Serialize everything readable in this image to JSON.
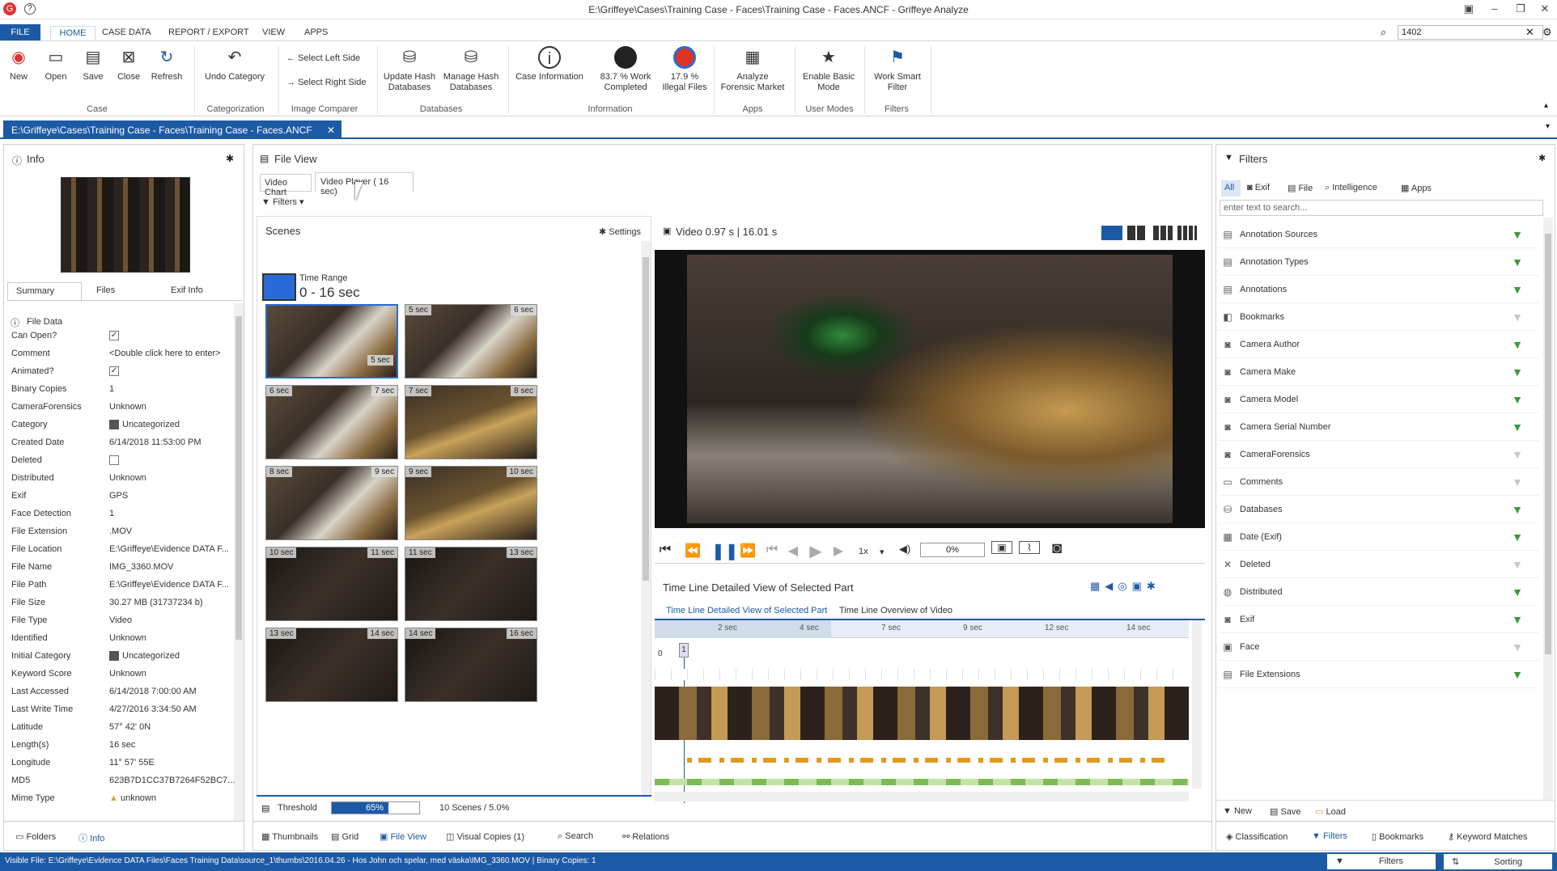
{
  "window": {
    "title": "E:\\Griffeye\\Cases\\Training Case - Faces\\Training Case - Faces.ANCF - Griffeye Analyze",
    "search_value": "1402"
  },
  "menu_tabs": [
    "FILE",
    "HOME",
    "CASE DATA",
    "REPORT / EXPORT",
    "VIEW",
    "APPS"
  ],
  "ribbon": {
    "new": "New",
    "open": "Open",
    "save": "Save",
    "close": "Close",
    "refresh": "Refresh",
    "undo_category": "Undo Category",
    "select_left": "Select Left Side",
    "select_right": "Select Right Side",
    "update_hash": "Update Hash Databases",
    "manage_hash": "Manage Hash Databases",
    "case_information": "Case Information",
    "work_completed": "83.7 % Work Completed",
    "illegal_files": "17.9 % Illegal Files",
    "analyze_market": "Analyze Forensic Market",
    "enable_basic": "Enable Basic Mode",
    "work_smart": "Work Smart Filter",
    "groups": {
      "case": "Case",
      "categorization": "Categorization",
      "image_comparer": "Image Comparer",
      "databases": "Databases",
      "information": "Information",
      "apps": "Apps",
      "user_modes": "User Modes",
      "filters": "Filters"
    }
  },
  "doc_tab": "E:\\Griffeye\\Cases\\Training Case - Faces\\Training Case - Faces.ANCF",
  "info_panel": {
    "title": "Info",
    "tabs": [
      "Summary",
      "Files",
      "Exif Info"
    ],
    "section": "File Data",
    "rows": [
      {
        "k": "Can Open?",
        "v": ""
      },
      {
        "k": "Comment",
        "v": "<Double click here to enter>"
      },
      {
        "k": "Animated?",
        "v": ""
      },
      {
        "k": "Binary Copies",
        "v": "1"
      },
      {
        "k": "CameraForensics",
        "v": "Unknown"
      },
      {
        "k": "Category",
        "v": "Uncategorized"
      },
      {
        "k": "Created Date",
        "v": "6/14/2018 11:53:00 PM"
      },
      {
        "k": "Deleted",
        "v": ""
      },
      {
        "k": "Distributed",
        "v": "Unknown"
      },
      {
        "k": "Exif",
        "v": "GPS"
      },
      {
        "k": "Face Detection",
        "v": "1"
      },
      {
        "k": "File Extension",
        "v": ".MOV"
      },
      {
        "k": "File Location",
        "v": "E:\\Griffeye\\Evidence DATA F..."
      },
      {
        "k": "File Name",
        "v": "IMG_3360.MOV"
      },
      {
        "k": "File Path",
        "v": "E:\\Griffeye\\Evidence DATA F..."
      },
      {
        "k": "File Size",
        "v": "30.27 MB  (31737234 b)"
      },
      {
        "k": "File Type",
        "v": "Video"
      },
      {
        "k": "Identified",
        "v": "Unknown"
      },
      {
        "k": "Initial Category",
        "v": "Uncategorized"
      },
      {
        "k": "Keyword Score",
        "v": "Unknown"
      },
      {
        "k": "Last Accessed",
        "v": "6/14/2018 7:00:00 AM"
      },
      {
        "k": "Last Write Time",
        "v": "4/27/2016 3:34:50 AM"
      },
      {
        "k": "Latitude",
        "v": "57° 42' 0N"
      },
      {
        "k": "Length(s)",
        "v": " 16 sec"
      },
      {
        "k": "Longitude",
        "v": "11° 57' 55E"
      },
      {
        "k": "MD5",
        "v": "623B7D1CC37B7264F52BC7..."
      },
      {
        "k": "Mime Type",
        "v": "unknown"
      }
    ],
    "bottom_tabs": [
      "Folders",
      "Info"
    ]
  },
  "file_view": {
    "title": "File View",
    "tabs": [
      "Video Chart",
      "Video Player ( 16 sec)"
    ],
    "filters_btn": "Filters",
    "scenes_title": "Scenes",
    "settings": "Settings",
    "time_range_label": "Time Range",
    "time_range_value": "0 -  16 sec",
    "thumbs": [
      {
        "tl": "",
        "tr": "",
        "br": "5 sec"
      },
      {
        "tl": "5 sec",
        "tr": "6 sec",
        "br": ""
      },
      {
        "tl": "6 sec",
        "tr": "7 sec",
        "br": ""
      },
      {
        "tl": "7 sec",
        "tr": "8 sec",
        "br": ""
      },
      {
        "tl": "8 sec",
        "tr": "9 sec",
        "br": ""
      },
      {
        "tl": "9 sec",
        "tr": "10 sec",
        "br": ""
      },
      {
        "tl": "10 sec",
        "tr": "11 sec",
        "br": ""
      },
      {
        "tl": "11 sec",
        "tr": "13 sec",
        "br": ""
      },
      {
        "tl": "13 sec",
        "tr": "14 sec",
        "br": ""
      },
      {
        "tl": "14 sec",
        "tr": "16 sec",
        "br": ""
      }
    ],
    "threshold_label": "Threshold",
    "threshold_value": "65%",
    "threshold_fraction": 0.65,
    "scenes_count": "10 Scenes / 5.0%",
    "video_header": "Video  0.97 s |   16.01 s",
    "speed": "1x",
    "progress": "0%",
    "timeline_title": "Time Line Detailed View of Selected Part",
    "timeline_tabs": [
      "Time Line Detailed View of Selected Part",
      "Time Line Overview of Video"
    ],
    "ticks": [
      "2 sec",
      "4 sec",
      "7 sec",
      "9 sec",
      "12 sec",
      "14 sec"
    ],
    "track_zero": "0",
    "marker": "1",
    "bottom_tabs": [
      "Thumbnails",
      "Grid",
      "File View",
      "Visual Copies (1)",
      "Search",
      "Relations"
    ]
  },
  "filters_panel": {
    "title": "Filters",
    "tabs": [
      "All",
      "Exif",
      "File",
      "Intelligence",
      "Apps"
    ],
    "search_placeholder": "enter text to search...",
    "items": [
      {
        "name": "Annotation Sources",
        "on": true
      },
      {
        "name": "Annotation Types",
        "on": true
      },
      {
        "name": "Annotations",
        "on": true
      },
      {
        "name": "Bookmarks",
        "on": false
      },
      {
        "name": "Camera Author",
        "on": true
      },
      {
        "name": "Camera Make",
        "on": true
      },
      {
        "name": "Camera Model",
        "on": true
      },
      {
        "name": "Camera Serial Number",
        "on": true
      },
      {
        "name": "CameraForensics",
        "on": false
      },
      {
        "name": "Comments",
        "on": false
      },
      {
        "name": "Databases",
        "on": true
      },
      {
        "name": "Date (Exif)",
        "on": true
      },
      {
        "name": "Deleted",
        "on": false
      },
      {
        "name": "Distributed",
        "on": true
      },
      {
        "name": "Exif",
        "on": true
      },
      {
        "name": "Face",
        "on": false
      },
      {
        "name": "File Extensions",
        "on": true
      }
    ],
    "actions": [
      "New",
      "Save",
      "Load"
    ],
    "bottom_tabs": [
      "Classification",
      "Filters",
      "Bookmarks",
      "Keyword Matches"
    ]
  },
  "status": {
    "text": "Visible File: E:\\Griffeye\\Evidence DATA Files\\Faces Training Data\\source_1\\thumbs\\2016.04.26 - Hos John och spelar, med väska\\IMG_3360.MOV  |  Binary Copies: 1",
    "filters": "Filters",
    "sorting": "Sorting"
  }
}
